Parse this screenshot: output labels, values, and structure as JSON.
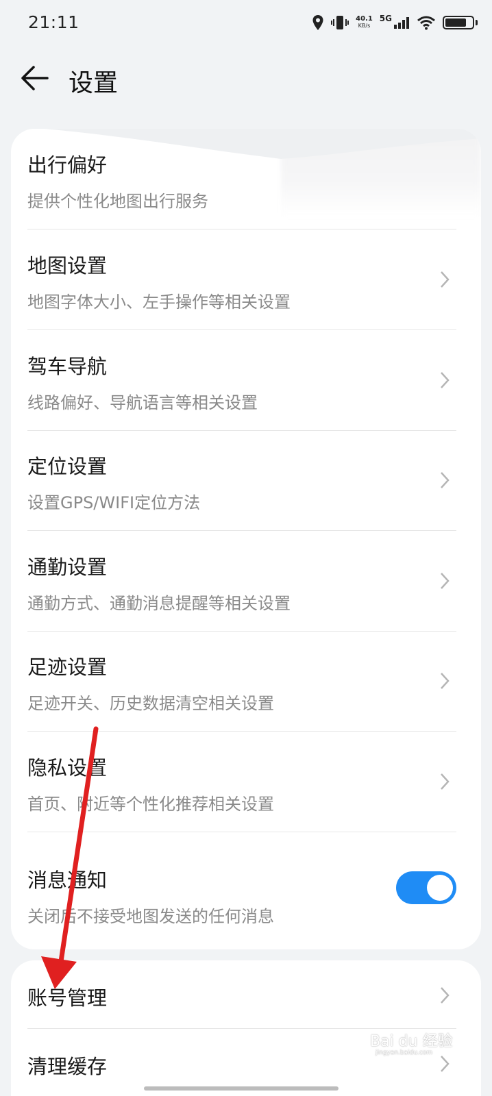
{
  "status_bar": {
    "time": "21:11",
    "net_speed": "40.1",
    "net_unit": "KB/s",
    "network": "5G",
    "icons": [
      "location-icon",
      "vibrate-icon",
      "signal-icon",
      "wifi-icon",
      "battery-icon"
    ]
  },
  "header": {
    "title": "设置",
    "back_icon": "back-arrow-icon"
  },
  "settings_group_1": [
    {
      "title": "出行偏好",
      "subtitle": "提供个性化地图出行服务",
      "control": "none"
    },
    {
      "title": "地图设置",
      "subtitle": "地图字体大小、左手操作等相关设置",
      "control": "chevron"
    },
    {
      "title": "驾车导航",
      "subtitle": "线路偏好、导航语言等相关设置",
      "control": "chevron"
    },
    {
      "title": "定位设置",
      "subtitle": "设置GPS/WIFI定位方法",
      "control": "chevron"
    },
    {
      "title": "通勤设置",
      "subtitle": "通勤方式、通勤消息提醒等相关设置",
      "control": "chevron"
    },
    {
      "title": "足迹设置",
      "subtitle": "足迹开关、历史数据清空相关设置",
      "control": "chevron"
    },
    {
      "title": "隐私设置",
      "subtitle": "首页、附近等个性化推荐相关设置",
      "control": "chevron"
    },
    {
      "title": "消息通知",
      "subtitle": "关闭后不接受地图发送的任何消息",
      "control": "toggle",
      "toggle_on": true
    }
  ],
  "settings_group_2": [
    {
      "title": "账号管理",
      "control": "chevron"
    },
    {
      "title": "清理缓存",
      "control": "chevron"
    }
  ],
  "colors": {
    "background": "#f1f3f5",
    "card": "#ffffff",
    "toggle_on": "#1f8cf5",
    "annotation_arrow": "#e02020",
    "subtitle": "#8a8a8a"
  },
  "watermark": {
    "brand": "Bai du 经验",
    "url": "jingyan.baidu.com"
  }
}
